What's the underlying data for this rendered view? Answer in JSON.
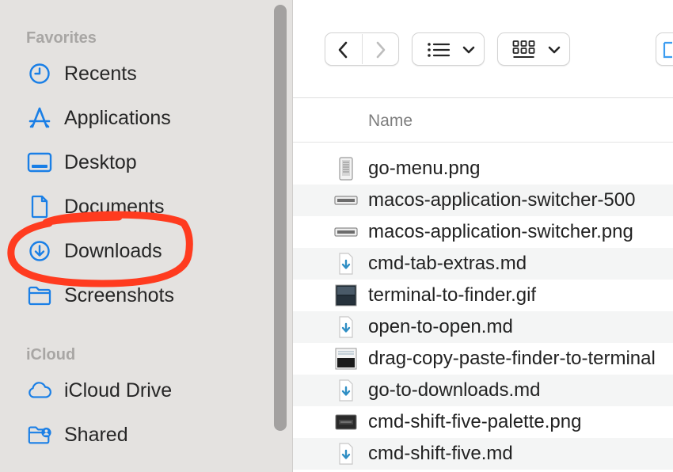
{
  "colors": {
    "sidebar_bg": "#e4e2e0",
    "accent_blue": "#1a7fe6",
    "annotation_red": "#ff3b1f",
    "section_header": "#a8a6a4",
    "row_alt": "#f4f5f5"
  },
  "sidebar": {
    "sections": [
      {
        "header": "Favorites",
        "items": [
          {
            "label": "Recents",
            "icon": "clock-icon"
          },
          {
            "label": "Applications",
            "icon": "applications-icon"
          },
          {
            "label": "Desktop",
            "icon": "desktop-icon"
          },
          {
            "label": "Documents",
            "icon": "document-icon"
          },
          {
            "label": "Downloads",
            "icon": "download-circle-icon"
          },
          {
            "label": "Screenshots",
            "icon": "folder-icon"
          }
        ]
      },
      {
        "header": "iCloud",
        "items": [
          {
            "label": "iCloud Drive",
            "icon": "cloud-icon"
          },
          {
            "label": "Shared",
            "icon": "shared-folder-icon"
          }
        ]
      }
    ]
  },
  "toolbar": {
    "back": "chevron-left-icon",
    "forward": "chevron-right-icon",
    "list_view": "list-view-icon",
    "grid_view": "grid-view-icon"
  },
  "columns": {
    "name": "Name"
  },
  "files": [
    {
      "name": "go-menu.png",
      "icon": "png-file-icon"
    },
    {
      "name": "macos-application-switcher-500",
      "icon": "image-file-icon"
    },
    {
      "name": "macos-application-switcher.png",
      "icon": "image-file-icon"
    },
    {
      "name": "cmd-tab-extras.md",
      "icon": "markdown-file-icon"
    },
    {
      "name": "terminal-to-finder.gif",
      "icon": "gif-file-icon"
    },
    {
      "name": "open-to-open.md",
      "icon": "markdown-file-icon"
    },
    {
      "name": "drag-copy-paste-finder-to-terminal",
      "icon": "image-file-icon"
    },
    {
      "name": "go-to-downloads.md",
      "icon": "markdown-file-icon"
    },
    {
      "name": "cmd-shift-five-palette.png",
      "icon": "png-file-icon"
    },
    {
      "name": "cmd-shift-five.md",
      "icon": "markdown-file-icon"
    }
  ]
}
